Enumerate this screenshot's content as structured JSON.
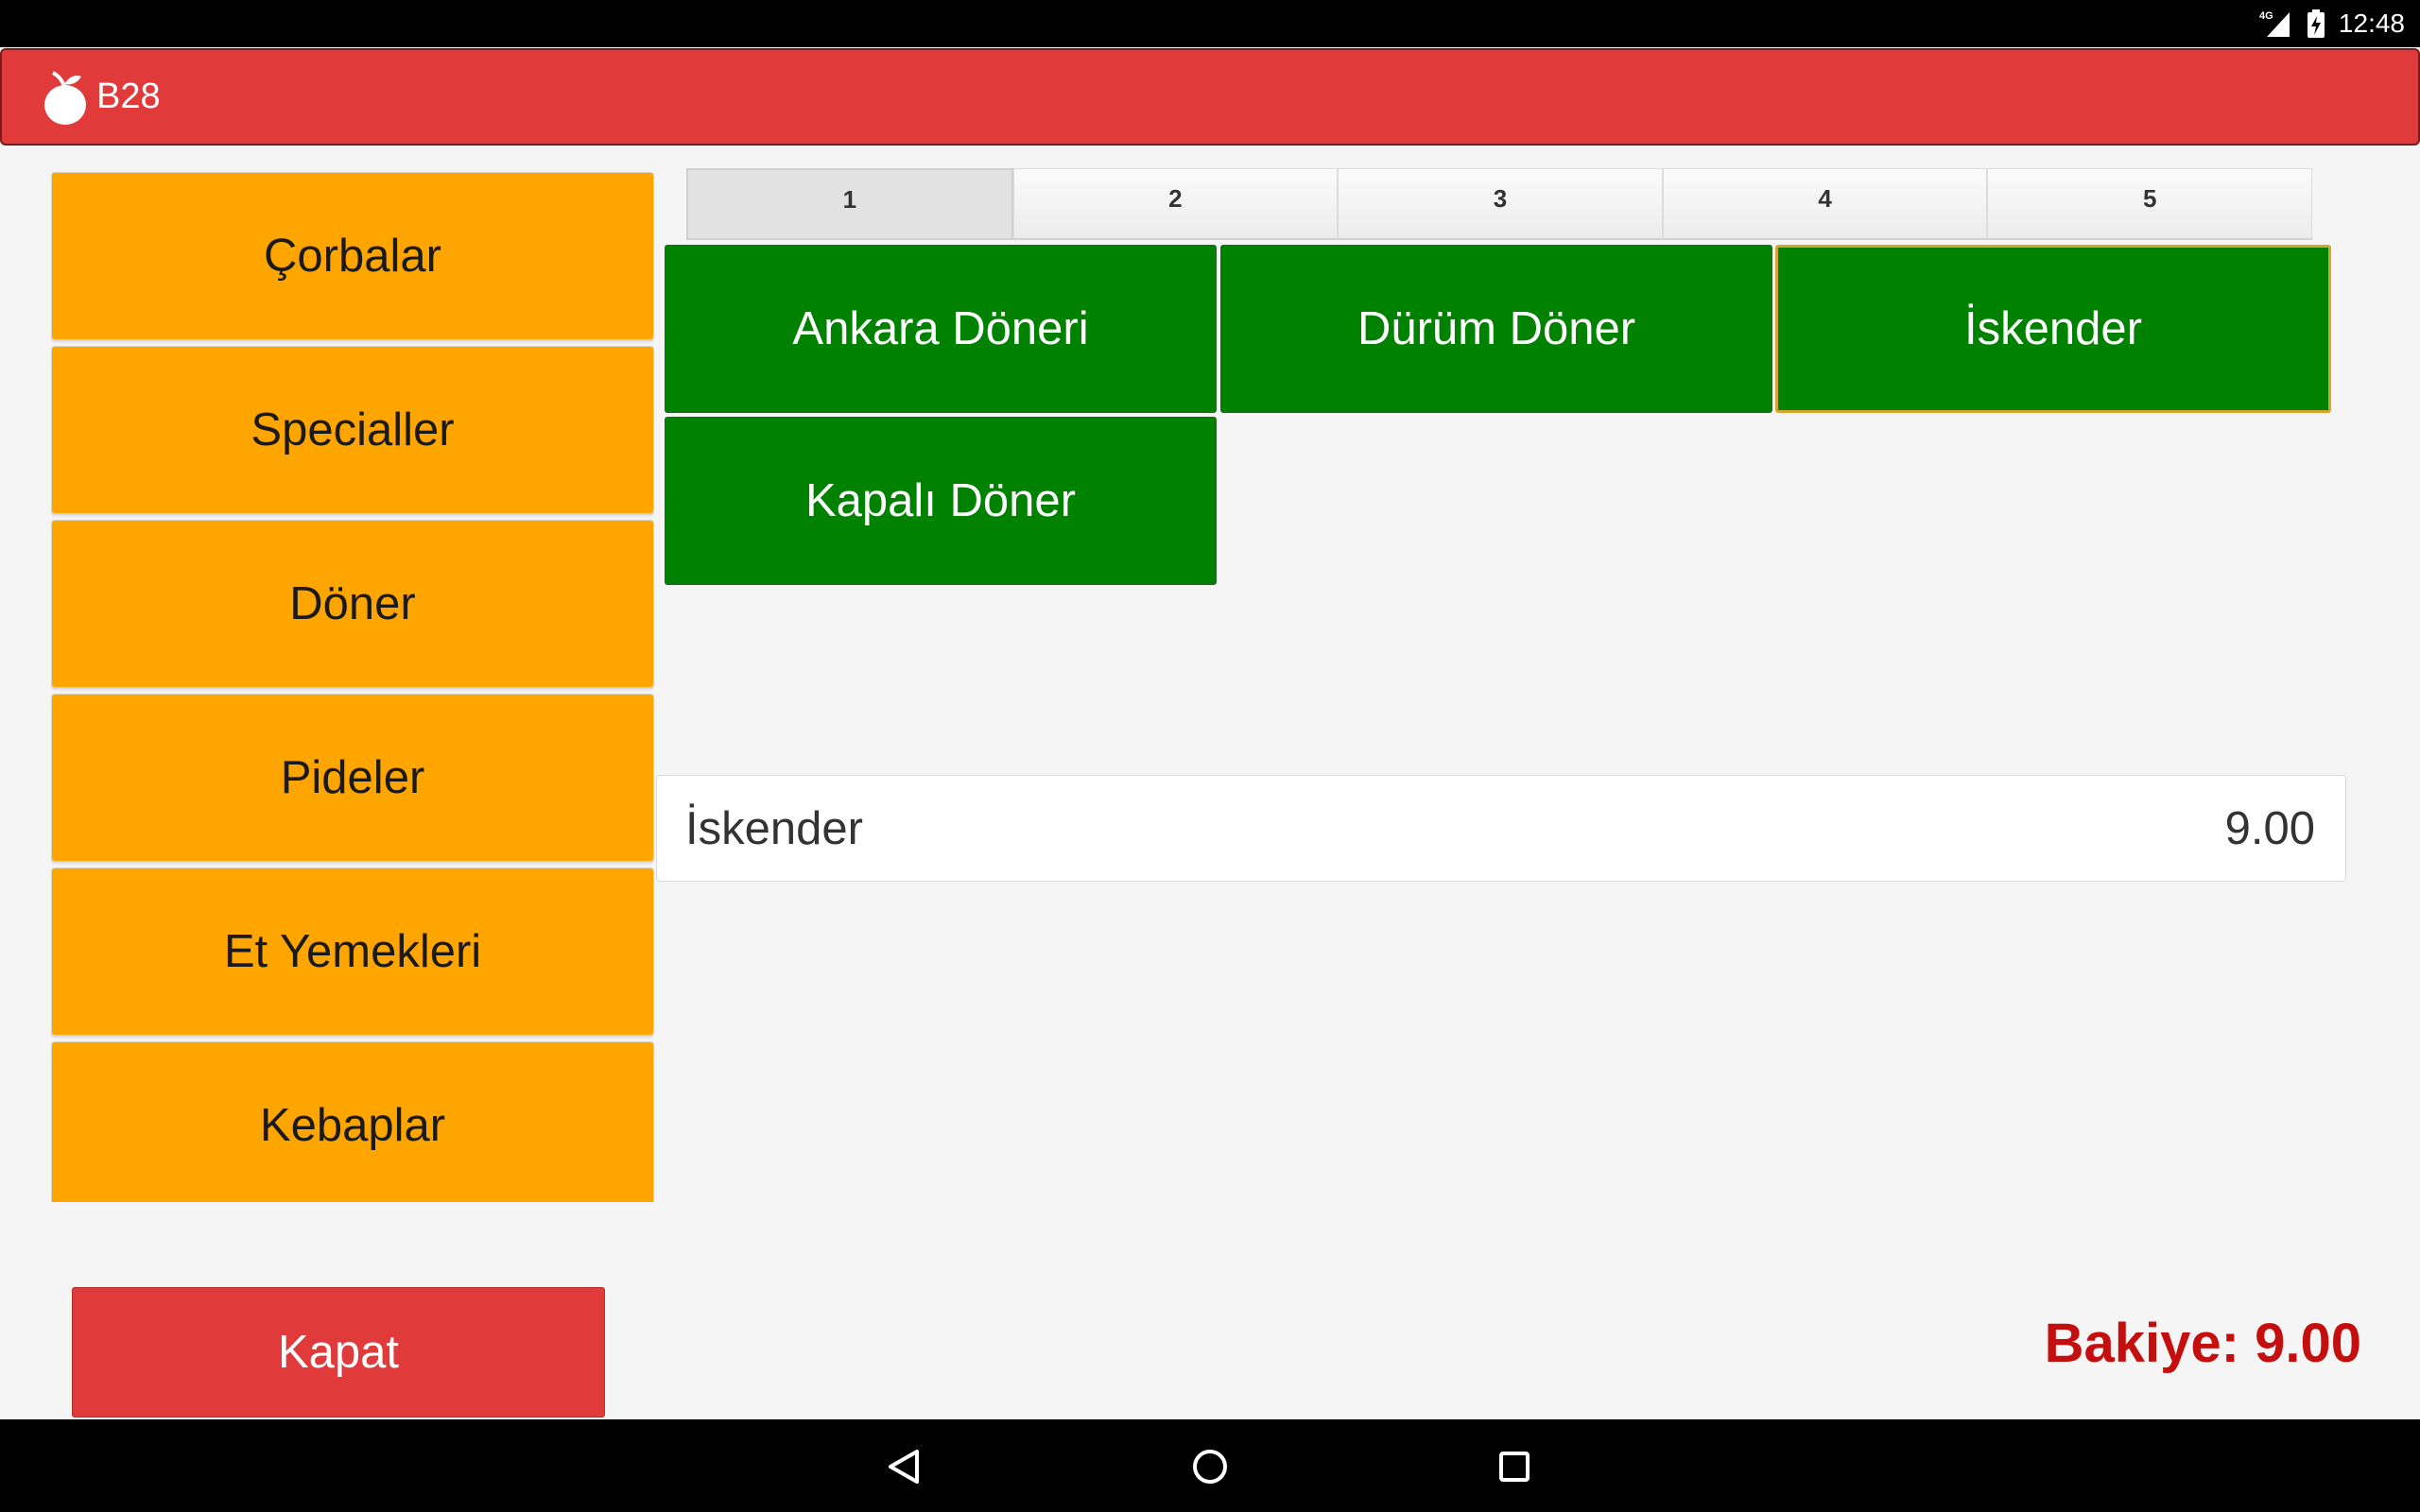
{
  "status_bar": {
    "network": "4G",
    "time": "12:48"
  },
  "header": {
    "title": "B28",
    "logo": "apple-logo-icon"
  },
  "categories": [
    {
      "label": "Çorbalar"
    },
    {
      "label": "Specialler"
    },
    {
      "label": "Döner"
    },
    {
      "label": "Pideler"
    },
    {
      "label": "Et Yemekleri"
    },
    {
      "label": "Kebaplar"
    }
  ],
  "page_tabs": [
    {
      "label": "1",
      "active": true
    },
    {
      "label": "2",
      "active": false
    },
    {
      "label": "3",
      "active": false
    },
    {
      "label": "4",
      "active": false
    },
    {
      "label": "5",
      "active": false
    }
  ],
  "products": [
    {
      "label": "Ankara Döneri",
      "selected": false
    },
    {
      "label": "Dürüm Döner",
      "selected": false
    },
    {
      "label": "İskender",
      "selected": true
    },
    {
      "label": "Kapalı Döner",
      "selected": false
    }
  ],
  "order": {
    "item_name": "İskender",
    "item_price": "9.00"
  },
  "footer": {
    "close_label": "Kapat",
    "balance_text": "Bakiye: 9.00"
  },
  "nav_bar": {
    "icons": [
      "back-icon",
      "home-icon",
      "recents-icon"
    ]
  },
  "colors": {
    "header": "#e03a3b",
    "category": "#ffa500",
    "product": "#008200",
    "selected_outline": "#d4a72c",
    "balance": "#c50f0f"
  }
}
